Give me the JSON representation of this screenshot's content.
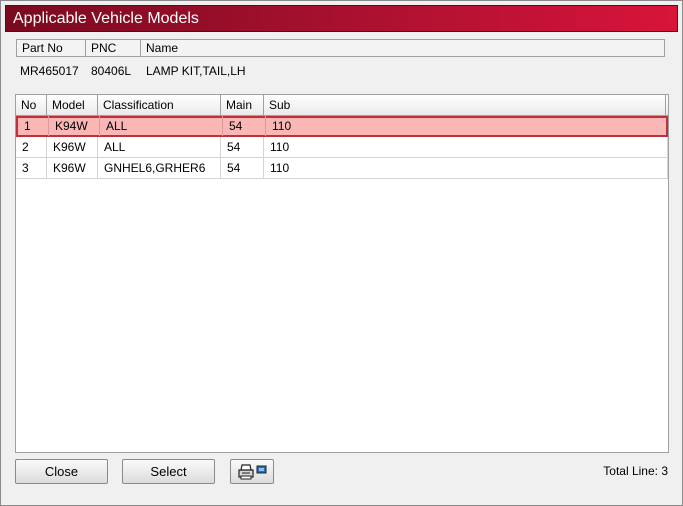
{
  "window": {
    "title": "Applicable Vehicle Models"
  },
  "part": {
    "headers": [
      "Part No",
      "PNC",
      "Name"
    ],
    "values": [
      "MR465017",
      "80406L",
      "LAMP KIT,TAIL,LH"
    ]
  },
  "grid": {
    "headers": [
      "No",
      "Model",
      "Classification",
      "Main",
      "Sub"
    ],
    "rows": [
      [
        "1",
        "K94W",
        "ALL",
        "54",
        "110"
      ],
      [
        "2",
        "K96W",
        "ALL",
        "54",
        "110"
      ],
      [
        "3",
        "K96W",
        "GNHEL6,GRHER6",
        "54",
        "110"
      ]
    ],
    "selected_row": 1
  },
  "buttons": {
    "close": "Close",
    "select": "Select",
    "print_icon": "printer-icon"
  },
  "footer": {
    "total": "Total Line: 3"
  },
  "colors": {
    "title_gradient_start": "#7a0a1e",
    "title_gradient_end": "#d8143a",
    "selected_row_bg": "#fbb6b6",
    "selected_row_border": "#c0303a"
  }
}
